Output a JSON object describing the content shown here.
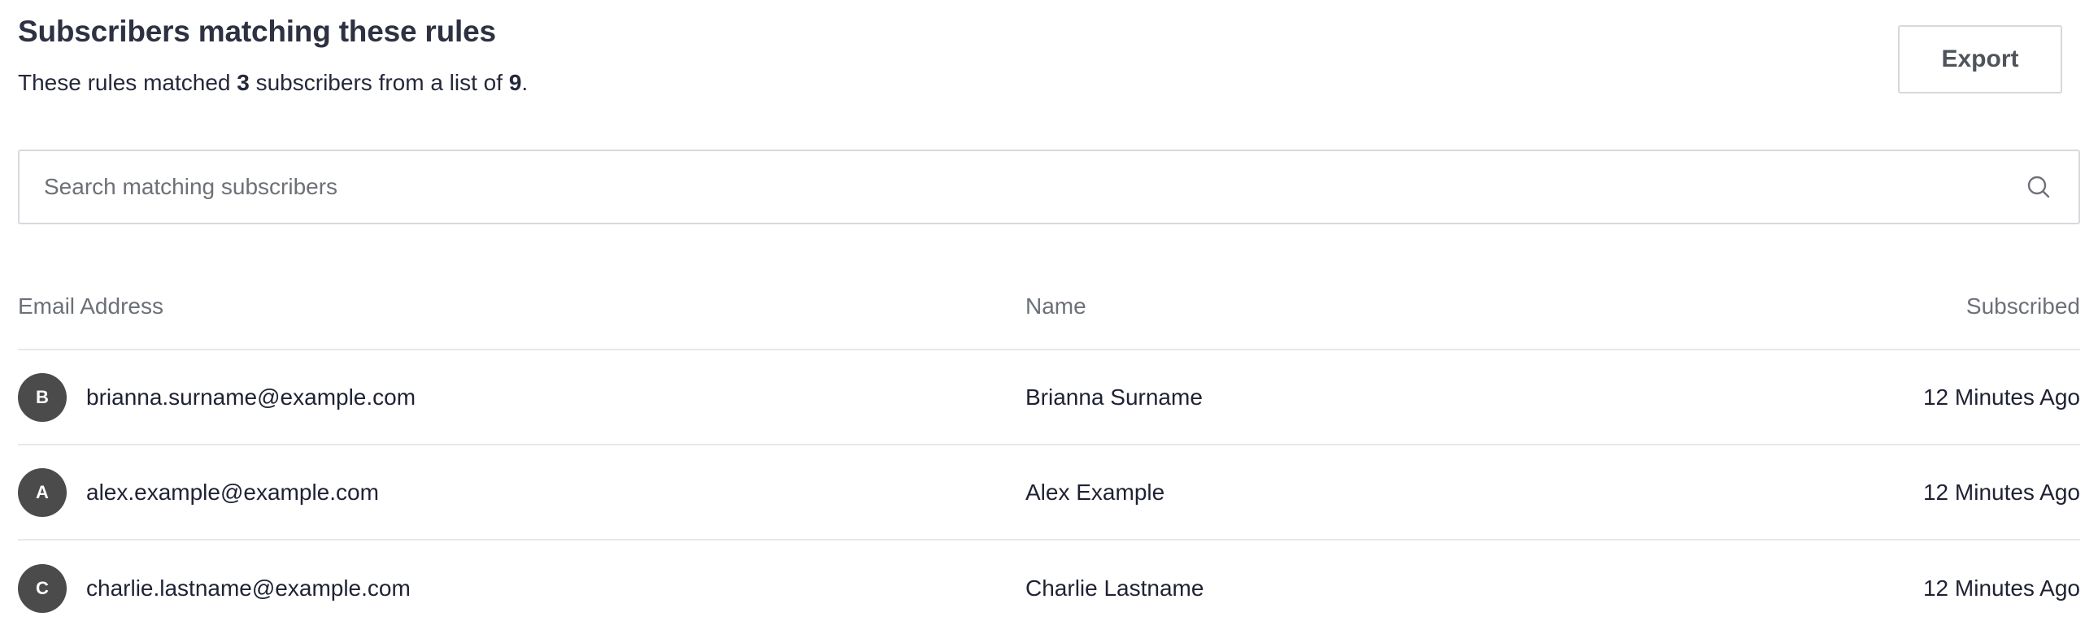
{
  "header": {
    "title": "Subscribers matching these rules",
    "summary_prefix": "These rules matched ",
    "matched_count": "3",
    "summary_middle": " subscribers from a list of ",
    "list_count": "9",
    "summary_suffix": ".",
    "export_label": "Export"
  },
  "search": {
    "placeholder": "Search matching subscribers",
    "value": "",
    "icon": "search-icon"
  },
  "table": {
    "columns": [
      "Email Address",
      "Name",
      "Subscribed"
    ],
    "rows": [
      {
        "avatar": "B",
        "email": "brianna.surname@example.com",
        "name": "Brianna Surname",
        "subscribed": "12 Minutes Ago"
      },
      {
        "avatar": "A",
        "email": "alex.example@example.com",
        "name": "Alex Example",
        "subscribed": "12 Minutes Ago"
      },
      {
        "avatar": "C",
        "email": "charlie.lastname@example.com",
        "name": "Charlie Lastname",
        "subscribed": "12 Minutes Ago"
      }
    ]
  },
  "colors": {
    "text": "#1f2233",
    "muted": "#6c7078",
    "border": "#d7d9dd",
    "divider": "#e7e8ea",
    "avatar": "#4b4b4b"
  }
}
